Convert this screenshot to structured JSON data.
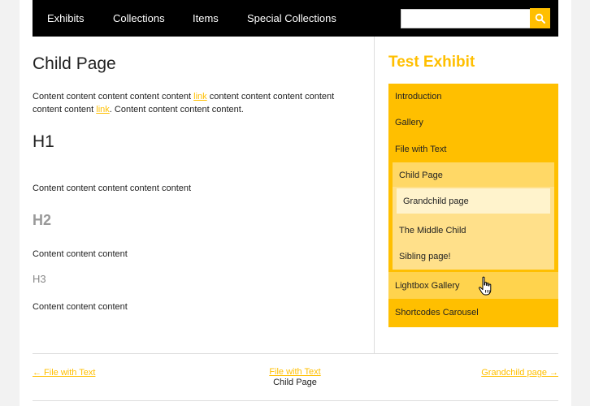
{
  "nav": {
    "items": [
      "Exhibits",
      "Collections",
      "Items",
      "Special Collections"
    ],
    "search_value": ""
  },
  "main": {
    "title": "Child Page",
    "para1": {
      "part1": "Content content content content content ",
      "link1": "link",
      "part2": " content content content content content content ",
      "link2": "link",
      "part3": ". Content content content content."
    },
    "h1": "H1",
    "para2": "Content content content content content",
    "h2": "H2",
    "para3": "Content content content",
    "h3": "H3",
    "para4": "Content content content"
  },
  "sidebar": {
    "title": "Test Exhibit",
    "items": {
      "introduction": "Introduction",
      "gallery": "Gallery",
      "file_with_text": "File with Text",
      "child_page": "Child Page",
      "grandchild_page": "Grandchild page",
      "middle_child": "The Middle Child",
      "sibling_page": "Sibling page!",
      "lightbox_gallery": "Lightbox Gallery",
      "shortcodes_carousel": "Shortcodes Carousel"
    }
  },
  "pager": {
    "prev": "← File with Text",
    "up_link": "File with Text",
    "current": "Child Page",
    "next": "Grandchild page →"
  },
  "colors": {
    "accent": "#ffbf00",
    "nav_bg": "#000000"
  }
}
